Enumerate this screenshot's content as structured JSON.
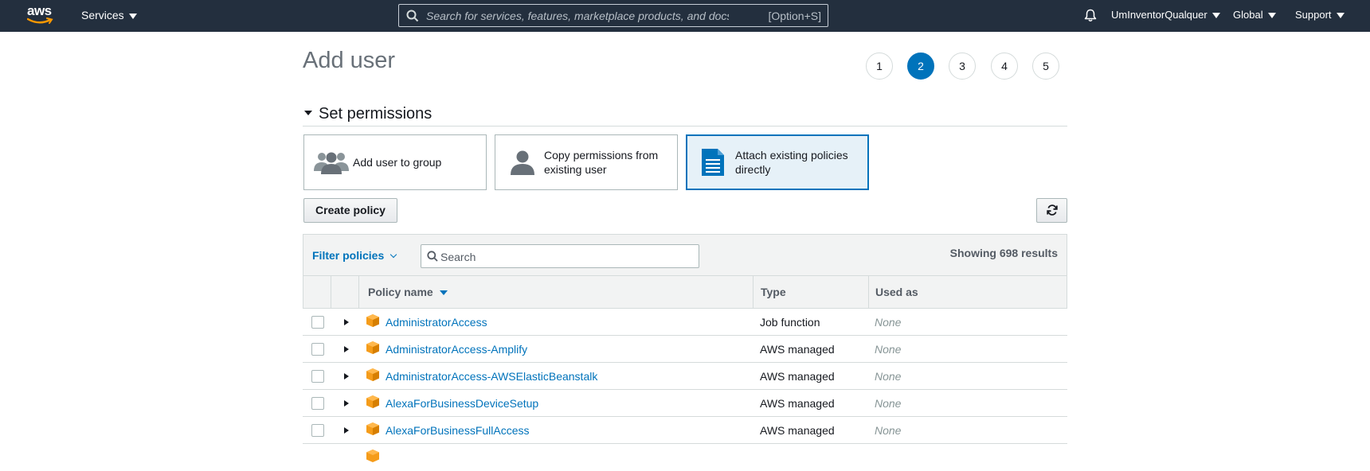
{
  "nav": {
    "logo": "aws",
    "services_label": "Services",
    "search_placeholder": "Search for services, features, marketplace products, and docs",
    "search_shortcut": "[Option+S]",
    "account": "UmInventorQualquer",
    "region": "Global",
    "support": "Support",
    "icons": {
      "search": "search-icon",
      "bell": "bell-icon"
    }
  },
  "page": {
    "title": "Add user",
    "steps": [
      "1",
      "2",
      "3",
      "4",
      "5"
    ],
    "active_step": "2"
  },
  "permissions": {
    "section_title": "Set permissions",
    "options": [
      {
        "label": "Add user to group",
        "icon": "group-icon",
        "selected": false
      },
      {
        "label": "Copy permissions from existing user",
        "icon": "user-icon",
        "selected": false
      },
      {
        "label": "Attach existing policies directly",
        "icon": "document-icon",
        "selected": true
      }
    ],
    "create_policy_label": "Create policy"
  },
  "table": {
    "filter_label": "Filter policies",
    "search_placeholder": "Search",
    "showing_text": "Showing 698 results",
    "columns": [
      "Policy name",
      "Type",
      "Used as"
    ],
    "rows": [
      {
        "name": "AdministratorAccess",
        "type": "Job function",
        "used_as": "None"
      },
      {
        "name": "AdministratorAccess-Amplify",
        "type": "AWS managed",
        "used_as": "None"
      },
      {
        "name": "AdministratorAccess-AWSElasticBeanstalk",
        "type": "AWS managed",
        "used_as": "None"
      },
      {
        "name": "AlexaForBusinessDeviceSetup",
        "type": "AWS managed",
        "used_as": "None"
      },
      {
        "name": "AlexaForBusinessFullAccess",
        "type": "AWS managed",
        "used_as": "None"
      }
    ]
  },
  "colors": {
    "nav_bg": "#232f3e",
    "accent": "#0073bb",
    "aws_orange": "#ff9900"
  }
}
